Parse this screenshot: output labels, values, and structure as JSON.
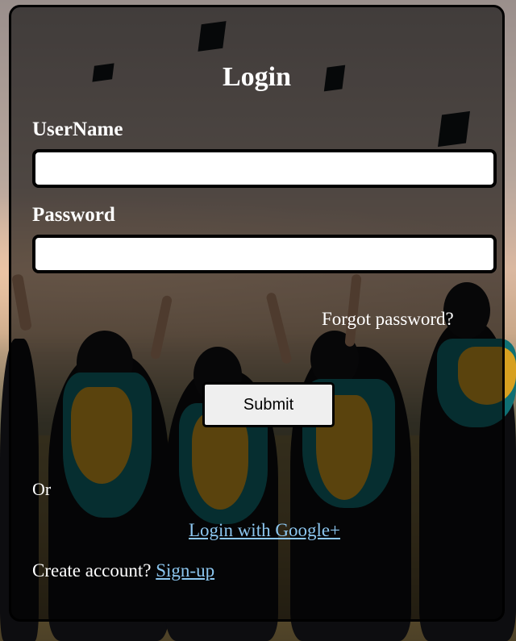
{
  "form": {
    "title": "Login",
    "username_label": "UserName",
    "username_value": "",
    "password_label": "Password",
    "password_value": "",
    "forgot_password": "Forgot password?",
    "submit_label": "Submit",
    "or_text": "Or",
    "google_login": "Login with Google+",
    "create_account_prompt": "Create account?",
    "signup_link": "Sign-up"
  },
  "colors": {
    "link": "#8cc6ef",
    "card_border": "#000000",
    "text": "#ffffff"
  }
}
